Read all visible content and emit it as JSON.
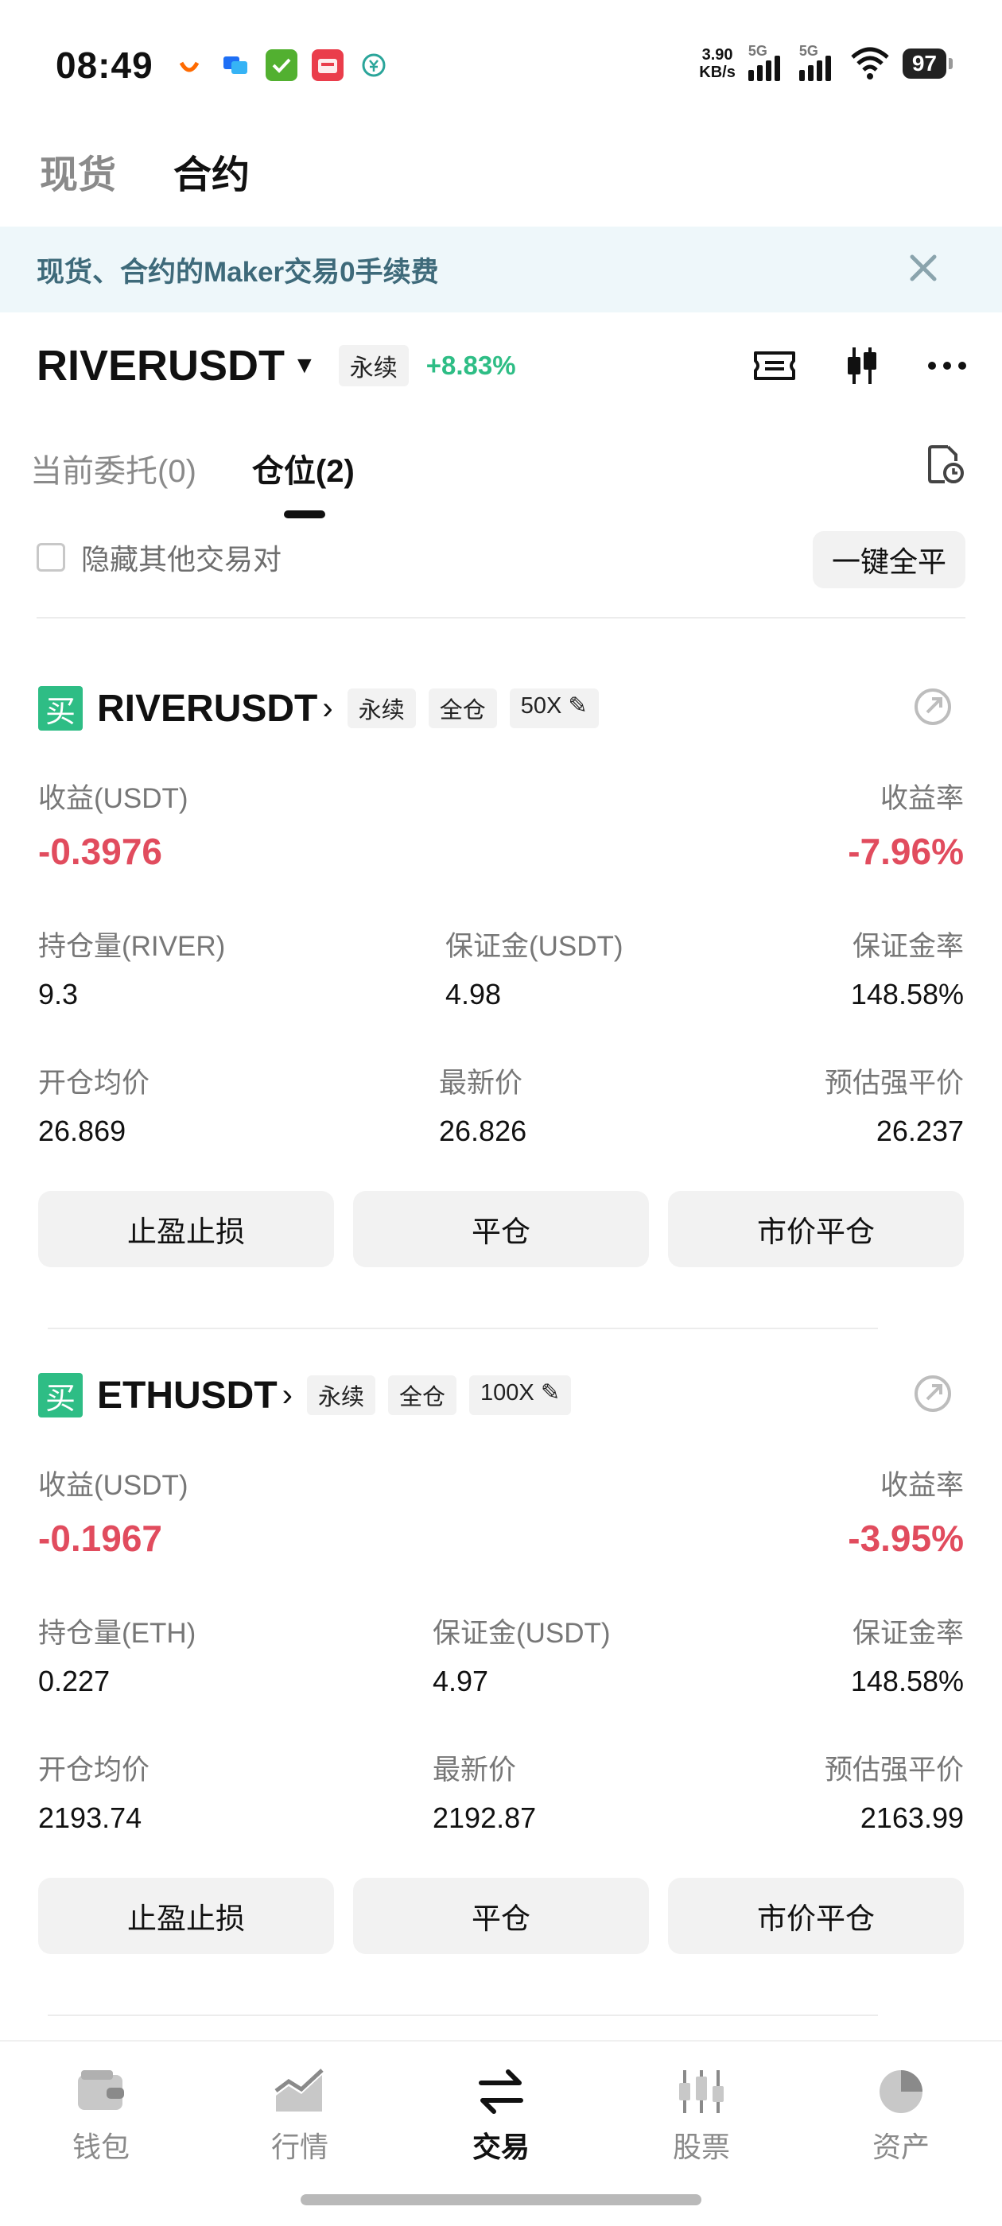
{
  "status_bar": {
    "time": "08:49",
    "net_speed_value": "3.90",
    "net_speed_unit": "KB/s",
    "sim1_label": "5G",
    "sim2_label": "5G",
    "battery": "97"
  },
  "top_tabs": [
    {
      "label": "现货",
      "active": false
    },
    {
      "label": "合约",
      "active": true
    }
  ],
  "banner": {
    "text": "现货、合约的Maker交易0手续费"
  },
  "symbol": {
    "name": "RIVERUSDT",
    "type_tag": "永续",
    "change": "+8.83%",
    "change_color": "#2ebd85"
  },
  "sub_tabs": [
    {
      "label": "当前委托(0)",
      "active": false
    },
    {
      "label": "仓位(2)",
      "active": true
    }
  ],
  "hide_other_pairs": {
    "label": "隐藏其他交易对",
    "checked": false
  },
  "close_all_button": "一键全平",
  "positions": [
    {
      "side_badge": "买",
      "symbol": "RIVERUSDT",
      "tags": [
        "永续",
        "全仓",
        "50X"
      ],
      "pnl_label": "收益(USDT)",
      "pnl_value": "-0.3976",
      "pnl_rate_label": "收益率",
      "pnl_rate_value": "-7.96%",
      "size_label": "持仓量(RIVER)",
      "size_value": "9.3",
      "margin_label": "保证金(USDT)",
      "margin_value": "4.98",
      "margin_ratio_label": "保证金率",
      "margin_ratio_value": "148.58%",
      "entry_label": "开仓均价",
      "entry_value": "26.869",
      "last_label": "最新价",
      "last_value": "26.826",
      "liq_label": "预估强平价",
      "liq_value": "26.237",
      "buttons": [
        "止盈止损",
        "平仓",
        "市价平仓"
      ]
    },
    {
      "side_badge": "买",
      "symbol": "ETHUSDT",
      "tags": [
        "永续",
        "全仓",
        "100X"
      ],
      "pnl_label": "收益(USDT)",
      "pnl_value": "-0.1967",
      "pnl_rate_label": "收益率",
      "pnl_rate_value": "-3.95%",
      "size_label": "持仓量(ETH)",
      "size_value": "0.227",
      "margin_label": "保证金(USDT)",
      "margin_value": "4.97",
      "margin_ratio_label": "保证金率",
      "margin_ratio_value": "148.58%",
      "entry_label": "开仓均价",
      "entry_value": "2193.74",
      "last_label": "最新价",
      "last_value": "2192.87",
      "liq_label": "预估强平价",
      "liq_value": "2163.99",
      "buttons": [
        "止盈止损",
        "平仓",
        "市价平仓"
      ]
    }
  ],
  "bottom_nav": [
    {
      "label": "钱包",
      "icon": "wallet-icon",
      "active": false
    },
    {
      "label": "行情",
      "icon": "market-chart-icon",
      "active": false
    },
    {
      "label": "交易",
      "icon": "swap-arrows-icon",
      "active": true
    },
    {
      "label": "股票",
      "icon": "candlestick-icon",
      "active": false
    },
    {
      "label": "资产",
      "icon": "pie-chart-icon",
      "active": false
    }
  ],
  "colors": {
    "profit_green": "#2ebd85",
    "loss_red": "#e14c5e",
    "banner_bg": "#eef7fa"
  }
}
